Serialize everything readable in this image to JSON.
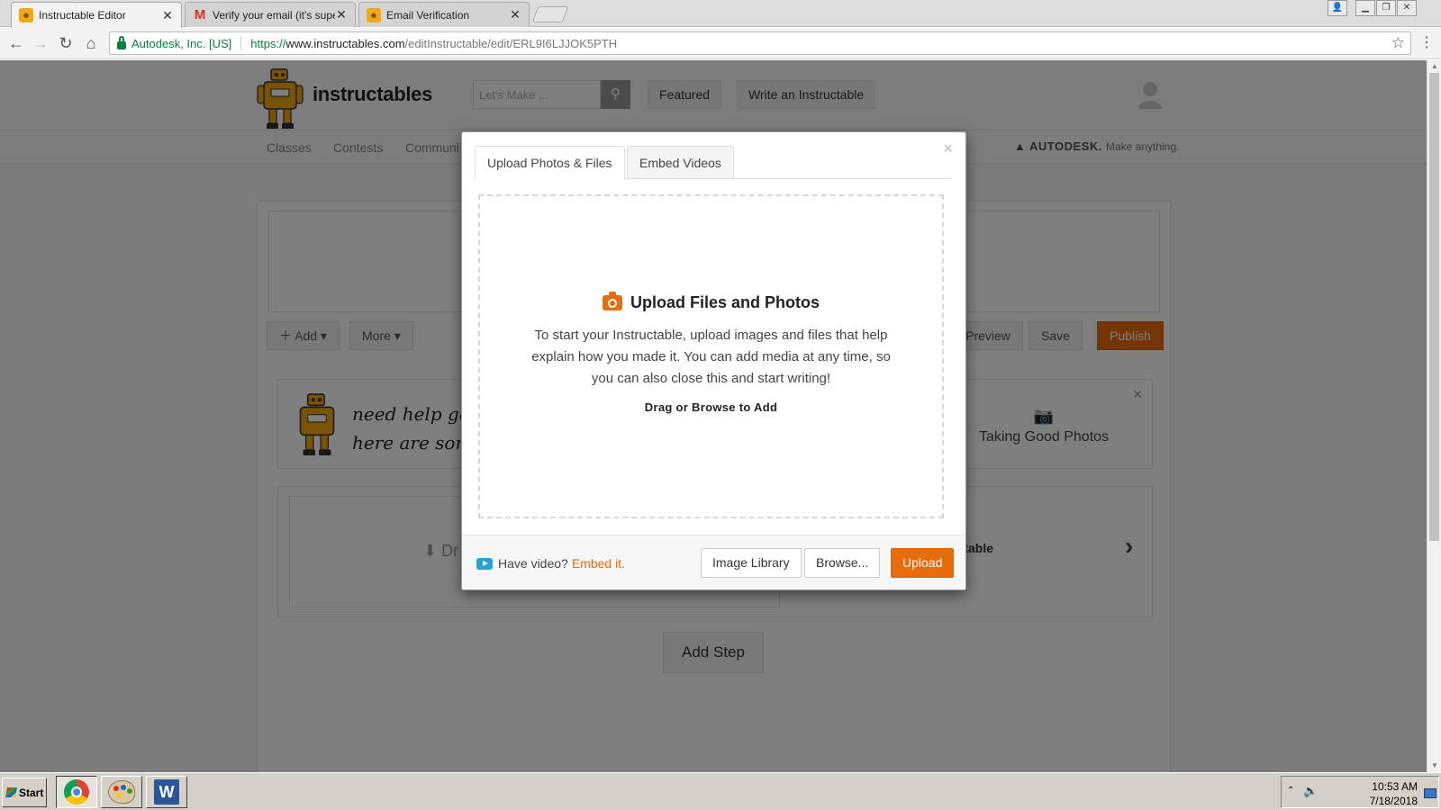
{
  "browser": {
    "tabs": [
      {
        "title": "Instructable Editor",
        "active": true,
        "icon": "instructables-robot-icon"
      },
      {
        "title": "Verify your email (it's super",
        "active": false,
        "icon": "gmail-icon"
      },
      {
        "title": "Email Verification",
        "active": false,
        "icon": "instructables-robot-icon"
      }
    ],
    "address": {
      "site_identity": "Autodesk, Inc. [US]",
      "scheme": "https://",
      "host": "www.instructables.com",
      "path": "/editInstructable/edit/ERL9I6LJJOK5PTH"
    }
  },
  "site": {
    "logo_text": "instructables",
    "search_placeholder": "Let's Make ...",
    "header_buttons": [
      "Featured",
      "Write an Instructable"
    ],
    "subnav": [
      "Classes",
      "Contests",
      "Communi"
    ],
    "autodesk_brand": "AUTODESK.",
    "autodesk_tagline": "Make anything."
  },
  "editor": {
    "toolbar": {
      "add": "Add",
      "more": "More",
      "preview": "ll Preview",
      "save": "Save",
      "publish": "Publish"
    },
    "help": {
      "text_line1": "need help gett",
      "text_line2": "here are some",
      "tip_label": "Taking Good Photos"
    },
    "step": {
      "drop_label": "Dr",
      "title_fragment": "uctable"
    },
    "add_step": "Add Step"
  },
  "modal": {
    "tabs": [
      "Upload Photos & Files",
      "Embed Videos"
    ],
    "active_tab": "Upload Photos & Files",
    "heading": "Upload Files and Photos",
    "description": "To start your Instructable, upload images and files that help explain how you made it. You can add media at any time, so you can also close this and start writing!",
    "drag_label": "Drag or Browse to Add",
    "video_note": "Have video?",
    "embed_link": "Embed it.",
    "buttons": {
      "image_library": "Image Library",
      "browse": "Browse...",
      "upload": "Upload"
    },
    "close": "×"
  },
  "taskbar": {
    "start": "Start",
    "apps": [
      "chrome-icon",
      "paint-icon",
      "word-icon"
    ],
    "time": "10:53 AM",
    "date": "7/18/2018"
  },
  "colors": {
    "accent": "#e86c0c",
    "secure_green": "#0b8043",
    "video_blue": "#27a0d6"
  }
}
